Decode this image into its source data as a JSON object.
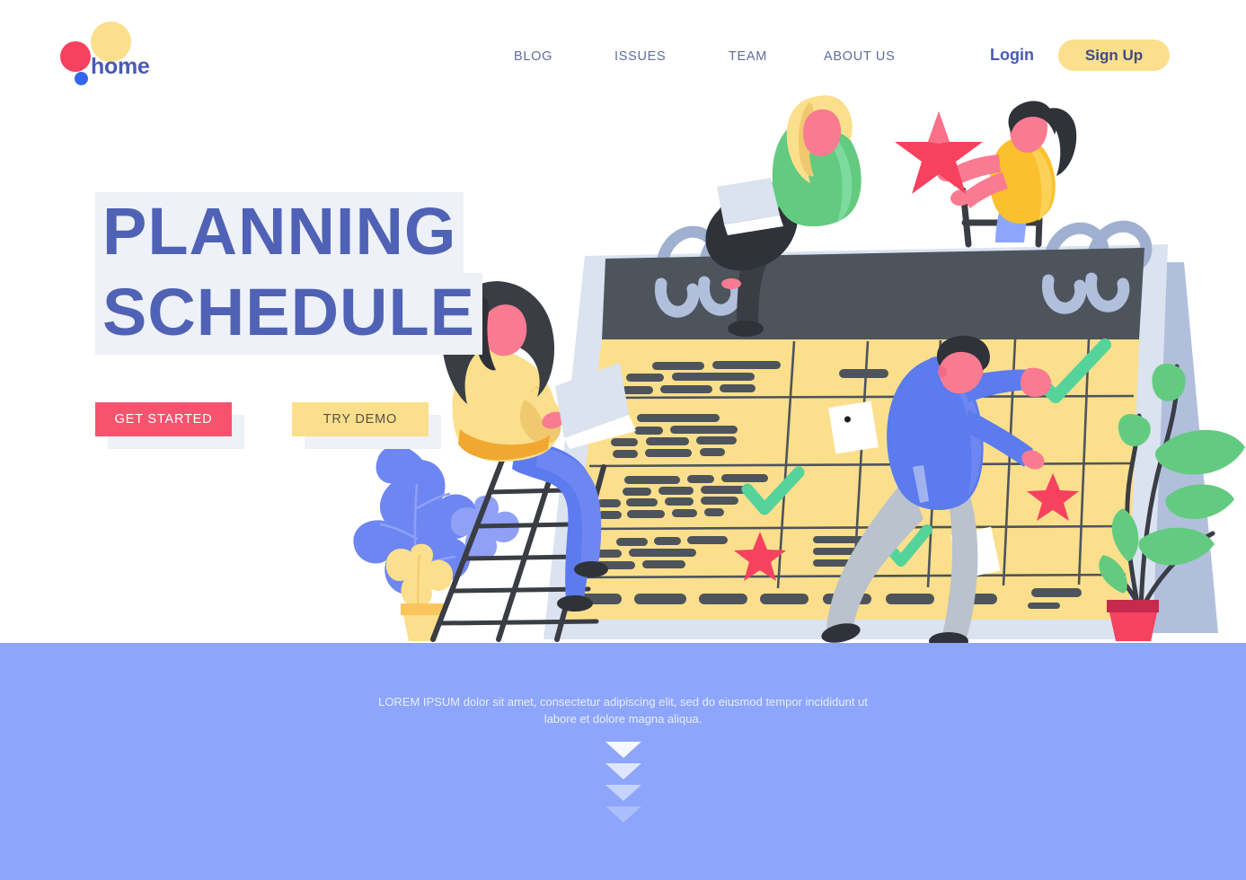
{
  "brand": {
    "name": "home",
    "dot_yellow": "#fbdf8c",
    "dot_red": "#f6415f",
    "dot_blue": "#3366f0",
    "text_color": "#4a5ab4"
  },
  "nav": {
    "items": [
      {
        "label": "BLOG"
      },
      {
        "label": "ISSUES"
      },
      {
        "label": "TEAM"
      },
      {
        "label": "ABOUT US"
      }
    ],
    "login_label": "Login",
    "signup_label": "Sign Up",
    "link_color": "#5f6d9e",
    "signup_bg": "#fbdf8c"
  },
  "hero": {
    "headline_line1": "PLANNING",
    "headline_line2": "SCHEDULE",
    "headline_color": "#4f62b5",
    "headline_highlight": "#eef1f7",
    "cta_primary": "GET STARTED",
    "cta_primary_bg": "#f6536e",
    "cta_secondary": "TRY DEMO",
    "cta_secondary_bg": "#fbdf8c"
  },
  "band": {
    "bg": "#8da6fb",
    "text": "LOREM IPSUM dolor sit amet, consectetur adipiscing elit, sed do eiusmod tempor incididunt ut labore et dolore magna aliqua.",
    "arrow_count": 4
  },
  "illustration": {
    "calendar": {
      "paper_color": "#fbdf8c",
      "header_color": "#4e545c",
      "frame_color": "#dbe2f0",
      "stand_color": "#b1bfdd",
      "ring_color": "#b1bfdd",
      "line_color": "#4e545c",
      "marks": [
        {
          "type": "check-mark",
          "color": "#54d39b"
        },
        {
          "type": "star-mark",
          "color": "#f6415f"
        },
        {
          "type": "sticky-note",
          "color": "#ffffff"
        }
      ]
    },
    "characters": [
      {
        "name": "woman-on-calendar-top-with-laptop",
        "shirt": "#5fd38d",
        "hair": "#fbdf8c"
      },
      {
        "name": "woman-holding-star",
        "shirt": "#fbc02d",
        "hair": "#2f3239",
        "star": "#f6415f"
      },
      {
        "name": "woman-on-ladder-with-laptop",
        "shirt": "#fbdf8c",
        "hair": "#3a3d44",
        "pants": "#5b7bee"
      },
      {
        "name": "man-marking-calendar",
        "shirt": "#5b7bee",
        "pants": "#b9c2cd",
        "hair": "#2f3239"
      }
    ],
    "plants": [
      {
        "name": "blue-leaf-plant-left",
        "leaf": "#6e86f2",
        "pot": "#fbc55e"
      },
      {
        "name": "green-plant-right",
        "leaf": "#63cb7f",
        "pot": "#f6415f"
      }
    ]
  }
}
